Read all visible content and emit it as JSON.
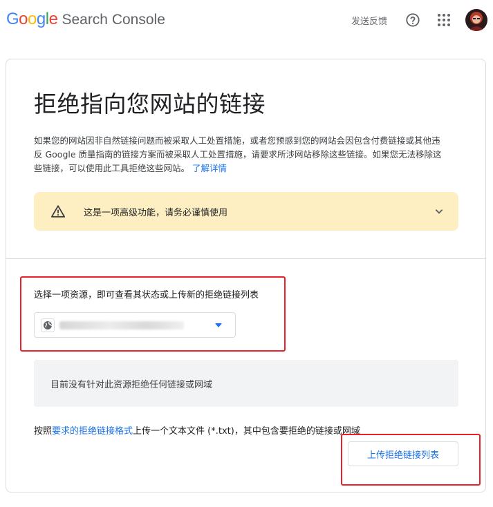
{
  "header": {
    "logo": {
      "letters": [
        {
          "ch": "G",
          "color": "#4285F4"
        },
        {
          "ch": "o",
          "color": "#EA4335"
        },
        {
          "ch": "o",
          "color": "#FBBC05"
        },
        {
          "ch": "g",
          "color": "#4285F4"
        },
        {
          "ch": "l",
          "color": "#34A853"
        },
        {
          "ch": "e",
          "color": "#EA4335"
        }
      ],
      "product": "Search Console"
    },
    "feedback_label": "发送反馈",
    "help_icon": "help-circle-icon",
    "apps_icon": "apps-grid-icon"
  },
  "main": {
    "title": "拒绝指向您网站的链接",
    "description": "如果您的网站因非自然链接问题而被采取人工处置措施，或者您预感到您的网站会因包含付费链接或其他违反 Google 质量指南的链接方案而被采取人工处置措施，请要求所涉网站移除这些链接。如果您无法移除这些链接，可以使用此工具拒绝这些网站。",
    "learn_more": "了解详情",
    "warning": {
      "text": "这是一项高级功能，请务必谨慎使用",
      "icon": "warning-triangle-icon",
      "expand_icon": "chevron-down-icon"
    },
    "property_label": "选择一项资源，即可查看其状态或上传新的拒绝链接列表",
    "property_select": {
      "icon": "globe-icon",
      "arrow_icon": "dropdown-arrow-icon"
    },
    "empty_message": "目前没有针对此资源拒绝任何链接或网域",
    "upload_prefix": "按照",
    "upload_link": "要求的拒绝链接格式",
    "upload_suffix": "上传一个文本文件 (*.txt)，其中包含要拒绝的链接或网域",
    "upload_button": "上传拒绝链接列表"
  },
  "colors": {
    "accent": "#1a73e8",
    "warning_bg": "#feefc3",
    "annotation_red": "#e8202a"
  }
}
